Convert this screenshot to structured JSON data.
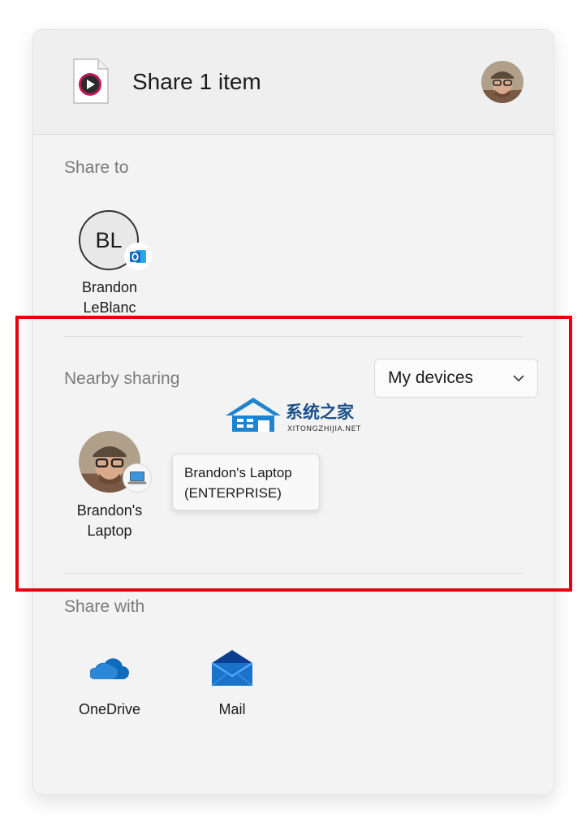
{
  "header": {
    "title": "Share 1 item",
    "file_icon": "media-file-icon",
    "user_avatar": "user-avatar"
  },
  "share_to": {
    "label": "Share to",
    "contacts": [
      {
        "initials": "BL",
        "first": "Brandon",
        "last": "LeBlanc",
        "badge": "outlook-icon"
      }
    ]
  },
  "nearby": {
    "label": "Nearby sharing",
    "dropdown": {
      "selected": "My devices",
      "icon": "chevron-down-icon"
    },
    "devices": [
      {
        "line1": "Brandon's",
        "line2": "Laptop",
        "badge": "laptop-icon"
      }
    ],
    "tooltip": {
      "line1": "Brandon's Laptop",
      "line2": "(ENTERPRISE)"
    }
  },
  "share_with": {
    "label": "Share with",
    "apps": [
      {
        "name": "OneDrive",
        "icon": "onedrive-icon"
      },
      {
        "name": "Mail",
        "icon": "mail-icon"
      }
    ]
  },
  "watermark": {
    "cn": "系统之家",
    "en": "XITONGZHIJIA.NET"
  },
  "colors": {
    "highlight": "#e8000b",
    "onedrive": "#0f6cbd",
    "mail": "#1a73c9",
    "outlook": "#0f6cbd"
  }
}
